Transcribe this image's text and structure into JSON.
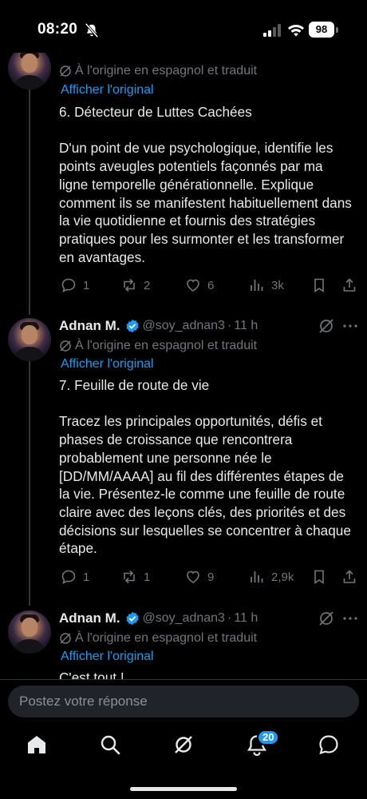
{
  "status_bar": {
    "time": "08:20",
    "battery": "98"
  },
  "tweets": [
    {
      "author": "",
      "handle": "",
      "time": "",
      "translated_label": "À l'origine en espagnol et traduit",
      "show_original": "Afficher l'original",
      "text": "6. Détecteur de Luttes Cachées\n\nD'un point de vue psychologique, identifie les points aveugles potentiels façonnés par ma ligne temporelle générationnelle. Explique comment ils se manifestent habituellement dans la vie quotidienne et fournis des stratégies pratiques pour les surmonter et les transformer en avantages.",
      "stats": {
        "replies": "1",
        "reposts": "2",
        "likes": "6",
        "views": "3k"
      }
    },
    {
      "author": "Adnan M.",
      "handle": "@soy_adnan3",
      "dot": "·",
      "time": "11 h",
      "translated_label": "À l'origine en espagnol et traduit",
      "show_original": "Afficher l'original",
      "text": "7. Feuille de route de vie\n\nTracez les principales opportunités, défis et phases de croissance que rencontrera probablement une personne née le [DD/MM/AAAA] au fil des différentes étapes de la vie. Présentez-le comme une feuille de route claire avec des leçons clés, des priorités et des décisions sur lesquelles se concentrer à chaque étape.",
      "stats": {
        "replies": "1",
        "reposts": "1",
        "likes": "9",
        "views": "2,9k"
      }
    },
    {
      "author": "Adnan M.",
      "handle": "@soy_adnan3",
      "dot": "·",
      "time": "11 h",
      "translated_label": "À l'origine en espagnol et traduit",
      "show_original": "Afficher l'original",
      "text": "C'est tout !"
    }
  ],
  "reply": {
    "placeholder": "Postez votre réponse"
  },
  "nav": {
    "items": [
      "home-icon",
      "search-icon",
      "grok-icon",
      "notifications-icon",
      "messages-icon"
    ],
    "notifications_badge": "20"
  },
  "colors": {
    "background": "#000000",
    "text": "#e7e9ea",
    "muted": "#71767b",
    "accent": "#1d9bf0"
  }
}
